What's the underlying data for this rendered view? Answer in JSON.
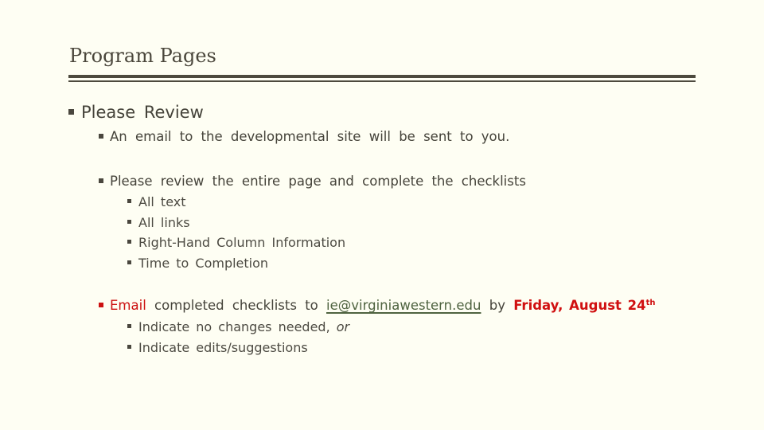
{
  "slide": {
    "title": "Program Pages",
    "colors": {
      "background": "#fefef3",
      "text": "#45433a",
      "rule": "#4d4a3e",
      "accent_red": "#cc1111",
      "link": "#4f6340"
    },
    "bullets": [
      {
        "text": "Please Review",
        "children": [
          {
            "text": "An email to the developmental site will be sent to you."
          },
          {
            "text": "Please review the entire page and complete the checklists",
            "children": [
              {
                "text": "All text"
              },
              {
                "text": "All links"
              },
              {
                "text": "Right-Hand Column Information"
              },
              {
                "text": "Time to Completion"
              }
            ]
          },
          {
            "lead": "Email",
            "middle": "completed checklists to",
            "link": "ie@virginiawestern.edu",
            "by": "by",
            "deadline": "Friday, August 24",
            "deadline_suffix": "th",
            "children": [
              {
                "text": "Indicate no changes needed,",
                "italic_suffix": "or"
              },
              {
                "text": "Indicate edits/suggestions"
              }
            ]
          }
        ]
      }
    ]
  }
}
